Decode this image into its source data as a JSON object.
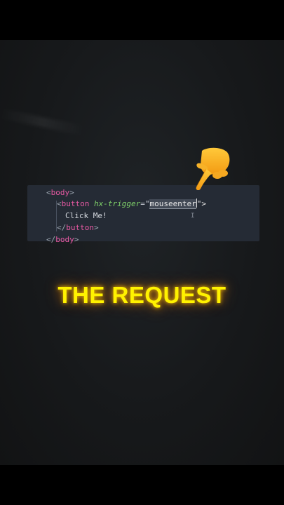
{
  "code": {
    "line1": {
      "open": "<",
      "tag": "body",
      "close": ">"
    },
    "line2": {
      "open": "<",
      "tag": "button",
      "attr": "hx-trigger",
      "eq": "=\"",
      "value": "mouseenter",
      "end": "\">"
    },
    "line3": {
      "text": "Click Me!"
    },
    "line4": {
      "open": "</",
      "tag": "button",
      "close": ">"
    },
    "line5": {
      "open": "</",
      "tag": "body",
      "close": ">"
    }
  },
  "overlay": {
    "pointer_icon": "backhand-index-pointing-down-emoji",
    "headline": "THE REQUEST"
  },
  "colors": {
    "background": "#17191b",
    "code_panel": "#252b35",
    "tag": "#e85aa4",
    "attribute": "#7fd16a",
    "headline": "#fff200"
  }
}
